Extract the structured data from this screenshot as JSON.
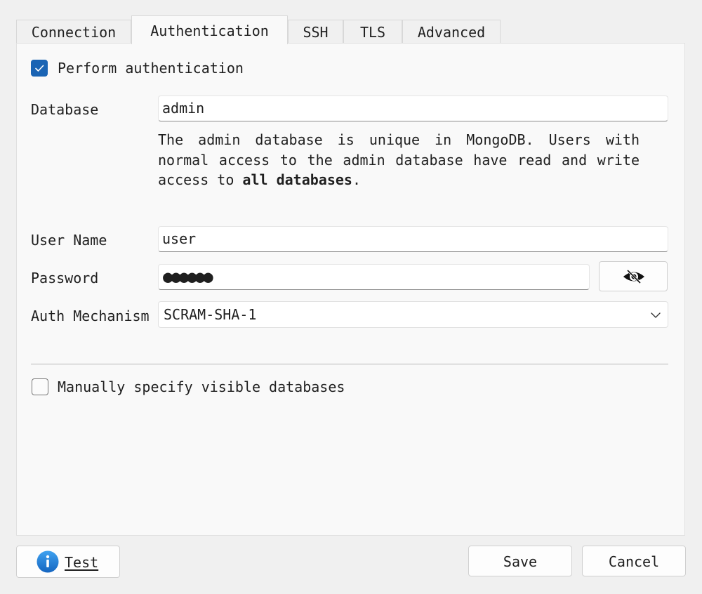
{
  "tabs": [
    {
      "label": "Connection",
      "active": false
    },
    {
      "label": "Authentication",
      "active": true
    },
    {
      "label": "SSH",
      "active": false
    },
    {
      "label": "TLS",
      "active": false
    },
    {
      "label": "Advanced",
      "active": false
    }
  ],
  "auth": {
    "perform_label": "Perform authentication",
    "perform_checked": true,
    "database_label": "Database",
    "database_value": "admin",
    "help_part1": "The admin database is unique in MongoDB. Users with normal access to the admin database have read and write access to ",
    "help_bold": "all databases",
    "help_part2": ".",
    "username_label": "User Name",
    "username_value": "user",
    "password_label": "Password",
    "password_mask": "●●●●●●",
    "mechanism_label": "Auth Mechanism",
    "mechanism_value": "SCRAM-SHA-1",
    "manual_label": "Manually specify visible databases",
    "manual_checked": false
  },
  "icons": {
    "checkbox_check": "checkmark-icon",
    "password_toggle": "eye-slash-icon",
    "select_arrow": "chevron-down-icon",
    "test_info": "info-icon"
  },
  "buttons": {
    "test_label": "Test",
    "save_label": "Save",
    "cancel_label": "Cancel"
  },
  "colors": {
    "accent": "#1a64b4",
    "info_blue": "#1e88e5"
  }
}
